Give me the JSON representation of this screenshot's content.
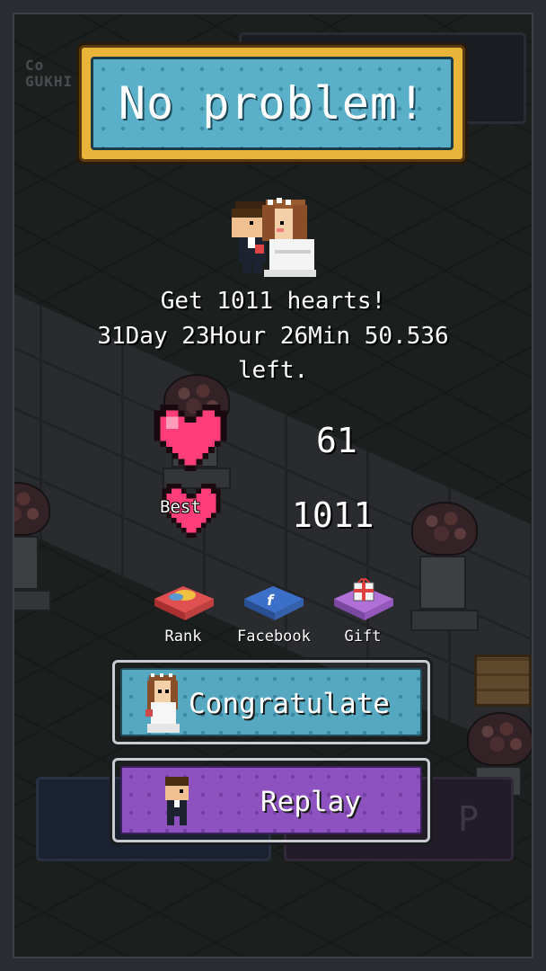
{
  "background": {
    "logo_text": "Co\nGUKHI",
    "replay_ghost_letter": "P"
  },
  "title": {
    "text": "No problem!"
  },
  "goal": {
    "line1": "Get 1011 hearts!",
    "line2": "31Day 23Hour 26Min 50.536",
    "line3": "left."
  },
  "stats": {
    "hearts_value": "61",
    "best_label": "Best",
    "best_value": "1011"
  },
  "social": {
    "rank_label": "Rank",
    "facebook_label": "Facebook",
    "gift_label": "Gift"
  },
  "buttons": {
    "congratulate_label": "Congratulate",
    "replay_label": "Replay"
  },
  "colors": {
    "heart": "#ff3d7a",
    "title_frame": "#e8b43a",
    "title_fill": "#5ab0c8",
    "congratulate_fill": "#56a8c0",
    "replay_fill": "#8e52c0"
  },
  "icons": [
    "couple-icon",
    "heart-icon",
    "best-heart-icon",
    "rank-icon",
    "facebook-icon",
    "gift-icon",
    "bride-icon",
    "groom-icon"
  ]
}
